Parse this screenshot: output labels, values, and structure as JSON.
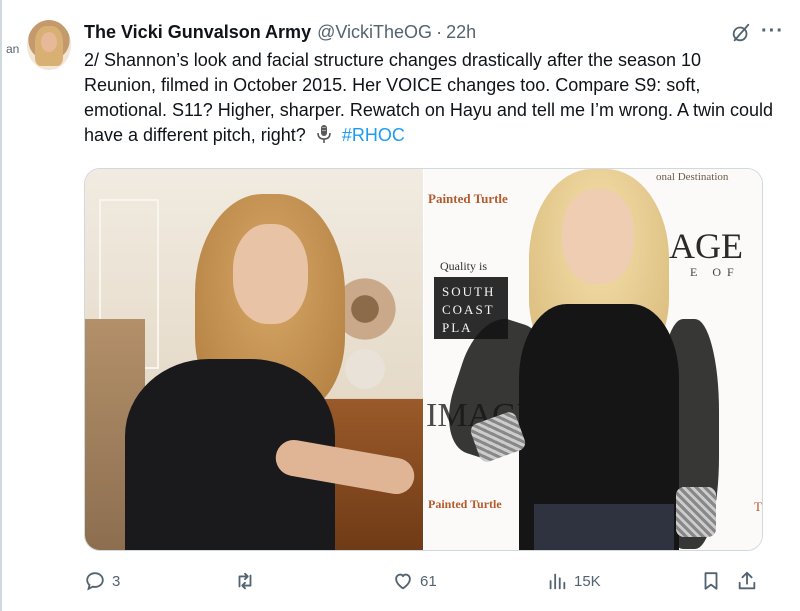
{
  "side_tag": "an",
  "author": {
    "display_name": "The Vicki Gunvalson Army",
    "handle": "@VickiTheOG",
    "separator": "·",
    "time": "22h"
  },
  "tweet": {
    "text": "2/ Shannon’s look and facial structure changes drastically after the season 10 Reunion, filmed in October 2015. Her VOICE changes too. Compare S9: soft, emotional. S11? Higher, sharper. Rewatch on Hayu and tell me I’m wrong. A twin could have a different pitch, right?",
    "mic_icon": "microphone-icon",
    "hashtag": "#RHOC"
  },
  "media": {
    "right_photo_text": {
      "top_banner": "onal Destination",
      "painted_turtle_top": "Painted Turtle",
      "quality": "Quality is",
      "south_coast": [
        "SOUTH",
        "COAST",
        "PLA"
      ],
      "age": "AGE",
      "eof": "E OF",
      "image": "IMAGE",
      "painted_turtle_bottom": "Painted Turtle",
      "t": "T"
    }
  },
  "actions": {
    "replies": "3",
    "retweets": "",
    "likes": "61",
    "views": "15K"
  },
  "colors": {
    "text": "#0f1419",
    "secondary": "#536471",
    "link": "#1d9bf0",
    "border": "#cfd9de"
  }
}
